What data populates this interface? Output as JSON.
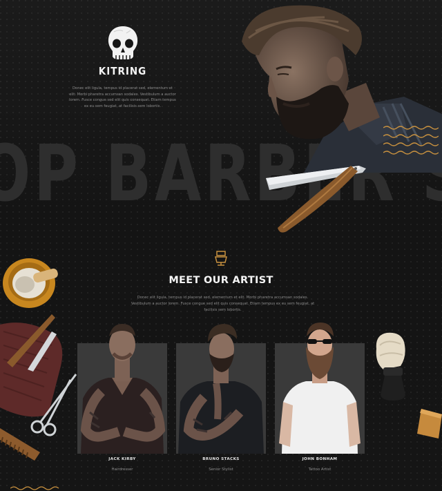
{
  "hero": {
    "background_word": "OP BARBER SH",
    "brand_name": "KITRING",
    "brand_text": "Donec elit ligula, tempus id placerat sed, elementum et elit. Morbi pharetra accumsan sodales. Vestibulum a auctor lorem. Fusce congue sed elit quis consequat. Etiam tempus ex eu sem feugiat, at facilisis sem lobortis.",
    "logo_icon": "skull-icon"
  },
  "artists_section": {
    "title": "MEET OUR ARTIST",
    "text": "Donec elit ligula, tempus id placerat sed, elementum et elit. Morbi pharetra accumsan sodales. Vestibulum a auctor lorem. Fusce congue sed elit quis consequat. Etiam tempus ex eu sem feugiat, at facilisis sem lobortis.",
    "icon": "barber-chair-icon",
    "artists": [
      {
        "name": "JACK KIRBY",
        "role": "Hairdresser"
      },
      {
        "name": "BRUNO STACKS",
        "role": "Senior Stylist"
      },
      {
        "name": "JOHN BONHAM",
        "role": "Tattoo Artist"
      }
    ]
  },
  "colors": {
    "background": "#161616",
    "accent": "#c8913f",
    "card": "#3a3a3a",
    "text_light": "#f4f4f4"
  }
}
